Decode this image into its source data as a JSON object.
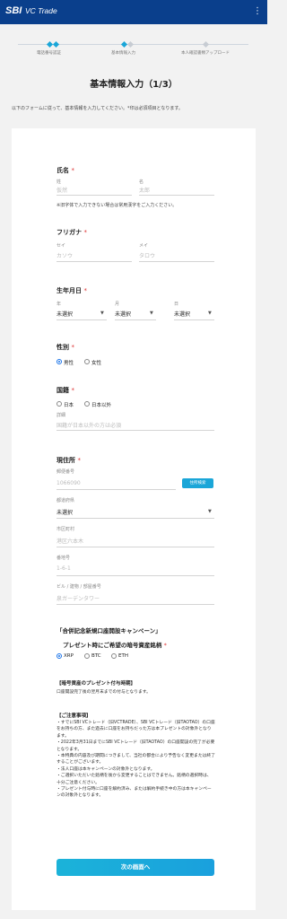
{
  "header": {
    "logo": "SBI",
    "logo_sub": "VC Trade",
    "menu": "⋮"
  },
  "stepper": {
    "steps": [
      {
        "label": "電話番号認証"
      },
      {
        "label": "基本情報入力"
      },
      {
        "label": "本人確認書類アップロード"
      }
    ]
  },
  "page": {
    "title": "基本情報入力（1/3）",
    "intro": "以下のフォームに従って、基本情報を入力してください。*印は必須項目となります。"
  },
  "name": {
    "title": "氏名",
    "req": "*",
    "last_label": "姓",
    "last_placeholder": "仮然",
    "first_label": "名",
    "first_placeholder": "太郎",
    "note": "※旧字体で入力できない場合は常用漢字をご入力ください。"
  },
  "kana": {
    "title": "フリガナ",
    "req": "*",
    "last_label": "セイ",
    "last_placeholder": "カソウ",
    "first_label": "メイ",
    "first_placeholder": "タロウ"
  },
  "birth": {
    "title": "生年月日",
    "req": "*",
    "year_label": "年",
    "year_value": "未選択",
    "month_label": "月",
    "month_value": "未選択",
    "day_label": "日",
    "day_value": "未選択"
  },
  "gender": {
    "title": "性別",
    "req": "*",
    "options": [
      "男性",
      "女性"
    ],
    "selected": "男性"
  },
  "nationality": {
    "title": "国籍",
    "req": "*",
    "options": [
      "日本",
      "日本以外"
    ],
    "detail_label": "詳細",
    "detail_placeholder": "国籍が日本以外の方は必須"
  },
  "address": {
    "title": "現住所",
    "req": "*",
    "zip_label": "郵便番号",
    "zip_placeholder": "1066090",
    "zip_button": "住所検索",
    "pref_label": "都道府県",
    "pref_value": "未選択",
    "city_label": "市区町村",
    "city_placeholder": "港区六本木",
    "street_label": "番地号",
    "street_placeholder": "1-6-1",
    "building_label": "ビル / 建物 / 部屋番号",
    "building_placeholder": "泉ガーデンタワー"
  },
  "campaign": {
    "title": "「合併記念新規口座開設キャンペーン」",
    "subtitle": "プレゼント時にご希望の暗号資産銘柄",
    "req": "*",
    "options": [
      "XRP",
      "BTC",
      "ETH"
    ],
    "selected": "XRP"
  },
  "timing": {
    "title": "【暗号資産のプレゼント付与時期】",
    "text": "口座開設完了後の翌月末までの付与となります。"
  },
  "caution": {
    "title": "【ご注意事項】",
    "items": [
      "・すでにSBI VCトレード（旧VCTRADE）、SBI VCトレード（旧TAOTAO）の口座をお持ちの方、また過去に口座をお持ちだった方は本プレゼントの対象外となります。",
      "・2022年3月31日までにSBI VCトレード（旧TAOTAO）の口座開設の完了が必要となります。",
      "・本特典の内容及び期間につきまして、当社の都合により予告なく変更または終了することがございます。",
      "・法人口座は本キャンペーンの対象外となります。",
      "・ご選択いただいた銘柄を後から変更することはできません。銘柄の選択時は、十分ご注意ください。",
      "・プレゼント付与時に口座を解約済み、または解約手続き中の方は本キャンペーンの対象外となります。"
    ]
  },
  "footer": {
    "next_button": "次の画面へ"
  }
}
